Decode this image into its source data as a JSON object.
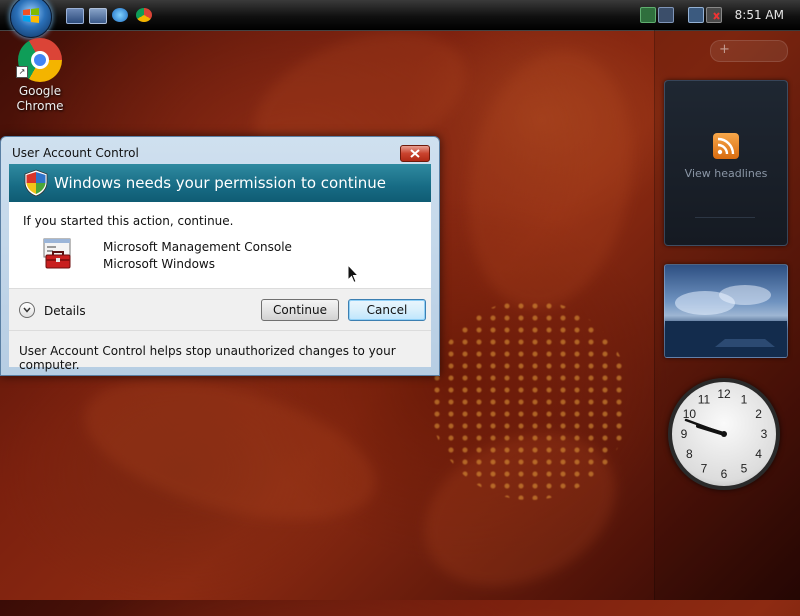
{
  "taskbar": {
    "time": "8:51 AM"
  },
  "desktop": {
    "icons": [
      {
        "label": "Google Chrome"
      }
    ]
  },
  "sidebar": {
    "feed_gadget_text": "View headlines",
    "clock": {
      "numbers": [
        "12",
        "1",
        "2",
        "3",
        "4",
        "5",
        "6",
        "7",
        "8",
        "9",
        "10",
        "11"
      ]
    }
  },
  "uac": {
    "window_title": "User Account Control",
    "heading": "Windows needs your permission to continue",
    "intro": "If you started this action, continue.",
    "program_name": "Microsoft Management Console",
    "publisher": "Microsoft Windows",
    "details_label": "Details",
    "continue_label": "Continue",
    "cancel_label": "Cancel",
    "footer": "User Account Control helps stop unauthorized changes to your computer."
  },
  "colors": {
    "banner": "#176b84",
    "taskbar": "#101010",
    "desktop_background": "#7b200e"
  }
}
